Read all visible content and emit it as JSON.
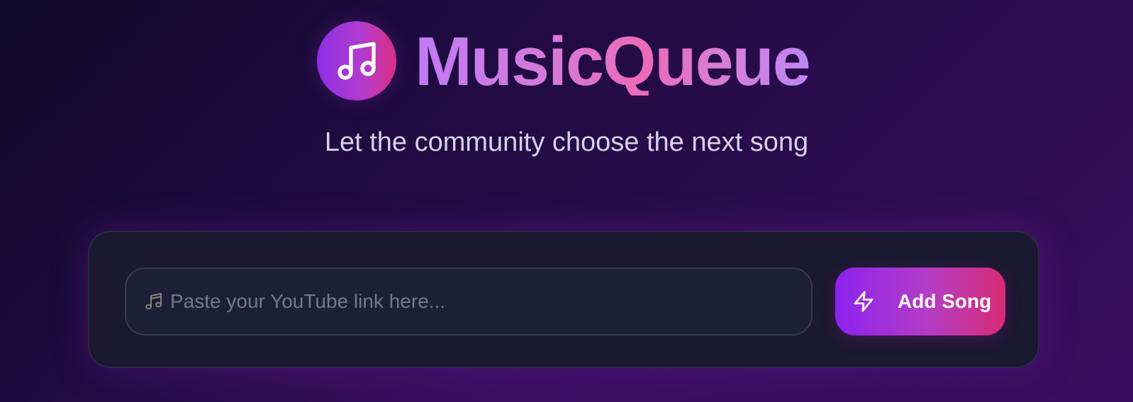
{
  "header": {
    "logo_icon": "music-note-icon",
    "app_name": "MusicQueue",
    "tagline": "Let the community choose the next song"
  },
  "add_song_form": {
    "url_input": {
      "icon": "music-notes-icon",
      "placeholder": "Paste your YouTube link here...",
      "value": ""
    },
    "submit_button": {
      "icon": "lightning-bolt-icon",
      "label": "Add Song"
    }
  },
  "colors": {
    "accent_purple": "#8d22ef",
    "accent_pink": "#d92b75",
    "card_background": "#1b1831",
    "input_background": "#1c1f36"
  }
}
